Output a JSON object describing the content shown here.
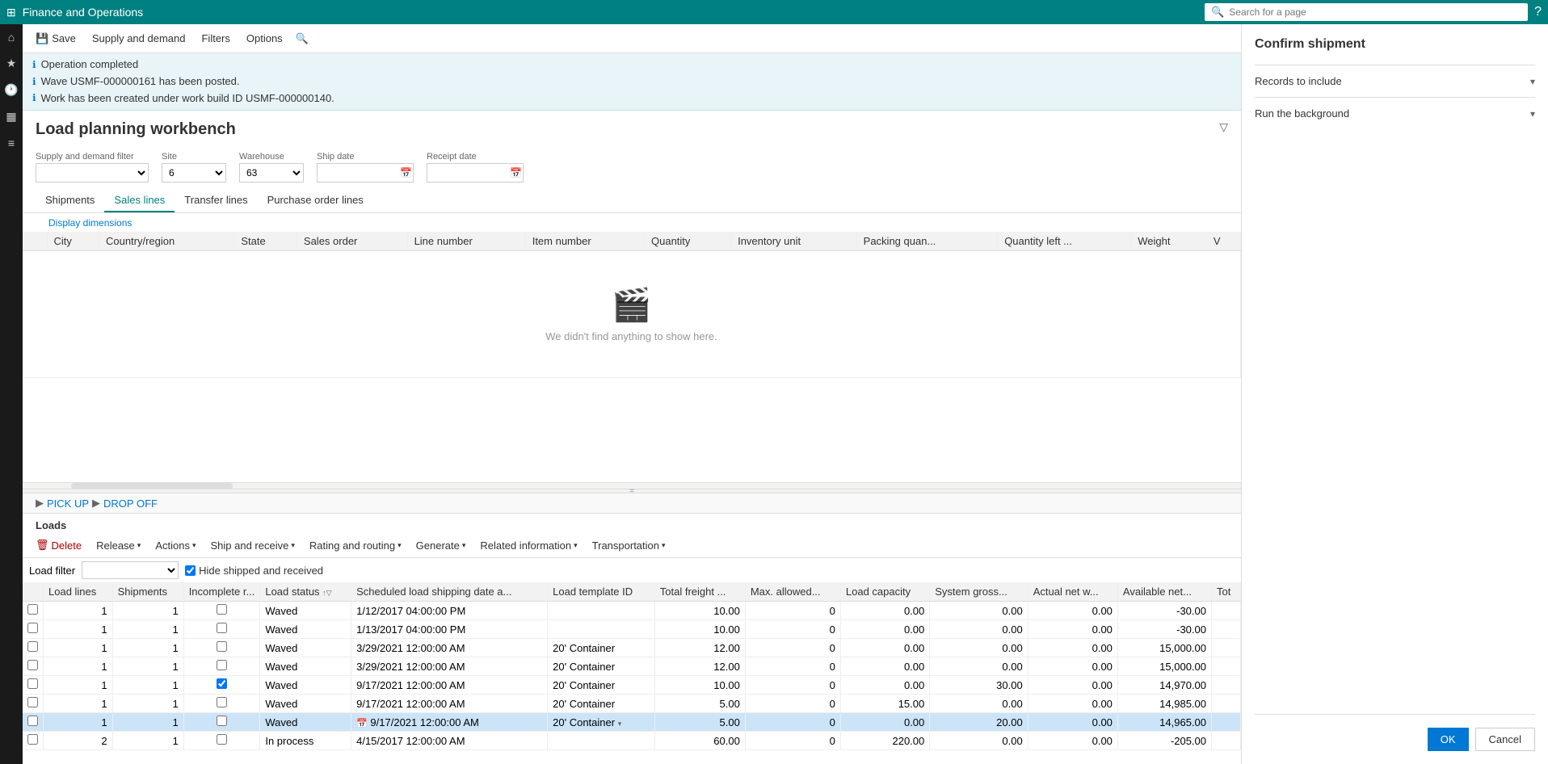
{
  "app": {
    "title": "Finance and Operations",
    "help_icon": "?"
  },
  "topbar": {
    "search_placeholder": "Search for a page"
  },
  "toolbar": {
    "save_label": "Save",
    "supply_demand_label": "Supply and demand",
    "filters_label": "Filters",
    "options_label": "Options"
  },
  "notifications": [
    {
      "text": "Operation completed"
    },
    {
      "text": "Wave USMF-000000161 has been posted."
    },
    {
      "text": "Work has been created under work build ID USMF-000000140."
    }
  ],
  "page": {
    "title": "Load planning workbench"
  },
  "filters": {
    "supply_demand_label": "Supply and demand filter",
    "supply_demand_value": "",
    "site_label": "Site",
    "site_value": "6",
    "warehouse_label": "Warehouse",
    "warehouse_value": "63",
    "ship_date_label": "Ship date",
    "ship_date_value": "",
    "receipt_date_label": "Receipt date",
    "receipt_date_value": ""
  },
  "tabs": [
    {
      "label": "Shipments",
      "active": false
    },
    {
      "label": "Sales lines",
      "active": true
    },
    {
      "label": "Transfer lines",
      "active": false
    },
    {
      "label": "Purchase order lines",
      "active": false
    }
  ],
  "display_dimensions": "Display dimensions",
  "sales_lines_grid": {
    "columns": [
      "City",
      "Country/region",
      "State",
      "Sales order",
      "Line number",
      "Item number",
      "Quantity",
      "Inventory unit",
      "Packing quan...",
      "Quantity left ...",
      "Weight",
      "V"
    ],
    "empty_text": "We didn't find anything to show here."
  },
  "breadcrumb": {
    "pickup": "PICK UP",
    "dropoff": "DROP OFF"
  },
  "loads": {
    "title": "Loads",
    "filter_label": "Load filter",
    "filter_value": "",
    "hide_shipped_label": "Hide shipped and received",
    "hide_shipped_checked": true
  },
  "loads_toolbar": {
    "delete_label": "Delete",
    "release_label": "Release",
    "actions_label": "Actions",
    "ship_receive_label": "Ship and receive",
    "rating_routing_label": "Rating and routing",
    "generate_label": "Generate",
    "related_info_label": "Related information",
    "transportation_label": "Transportation"
  },
  "loads_grid": {
    "columns": [
      "Load lines",
      "Shipments",
      "Incomplete r...",
      "Load status",
      "Scheduled load shipping date a...",
      "Load template ID",
      "Total freight ...",
      "Max. allowed...",
      "Load capacity",
      "System gross...",
      "Actual net w...",
      "Available net...",
      "Tot"
    ],
    "rows": [
      {
        "load_lines": "1",
        "shipments": "1",
        "incomplete": false,
        "load_status": "Waved",
        "ship_date": "1/12/2017 04:00:00 PM",
        "template_id": "",
        "total_freight": "10.00",
        "max_allowed": "0",
        "load_capacity": "0.00",
        "sys_gross": "0.00",
        "actual_net": "0.00",
        "available_net": "-30.00",
        "tot": "",
        "selected": false
      },
      {
        "load_lines": "1",
        "shipments": "1",
        "incomplete": false,
        "load_status": "Waved",
        "ship_date": "1/13/2017 04:00:00 PM",
        "template_id": "",
        "total_freight": "10.00",
        "max_allowed": "0",
        "load_capacity": "0.00",
        "sys_gross": "0.00",
        "actual_net": "0.00",
        "available_net": "-30.00",
        "tot": "",
        "selected": false
      },
      {
        "load_lines": "1",
        "shipments": "1",
        "incomplete": false,
        "load_status": "Waved",
        "ship_date": "3/29/2021 12:00:00 AM",
        "template_id": "20' Container",
        "total_freight": "12.00",
        "max_allowed": "0",
        "load_capacity": "0.00",
        "sys_gross": "0.00",
        "actual_net": "0.00",
        "available_net": "15,000.00",
        "tot": "",
        "selected": false
      },
      {
        "load_lines": "1",
        "shipments": "1",
        "incomplete": false,
        "load_status": "Waved",
        "ship_date": "3/29/2021 12:00:00 AM",
        "template_id": "20' Container",
        "total_freight": "12.00",
        "max_allowed": "0",
        "load_capacity": "0.00",
        "sys_gross": "0.00",
        "actual_net": "0.00",
        "available_net": "15,000.00",
        "tot": "",
        "selected": false
      },
      {
        "load_lines": "1",
        "shipments": "1",
        "incomplete": true,
        "load_status": "Waved",
        "ship_date": "9/17/2021 12:00:00 AM",
        "template_id": "20' Container",
        "total_freight": "10.00",
        "max_allowed": "0",
        "load_capacity": "0.00",
        "sys_gross": "30.00",
        "actual_net": "0.00",
        "available_net": "14,970.00",
        "tot": "",
        "selected": false
      },
      {
        "load_lines": "1",
        "shipments": "1",
        "incomplete": false,
        "load_status": "Waved",
        "ship_date": "9/17/2021 12:00:00 AM",
        "template_id": "20' Container",
        "total_freight": "5.00",
        "max_allowed": "0",
        "load_capacity": "15.00",
        "sys_gross": "0.00",
        "actual_net": "0.00",
        "available_net": "14,985.00",
        "tot": "",
        "selected": false
      },
      {
        "load_lines": "1",
        "shipments": "1",
        "incomplete": false,
        "load_status": "Waved",
        "ship_date": "9/17/2021 12:00:00 AM",
        "template_id": "20' Container",
        "total_freight": "5.00",
        "max_allowed": "0",
        "load_capacity": "0.00",
        "sys_gross": "20.00",
        "actual_net": "0.00",
        "available_net": "14,965.00",
        "tot": "",
        "selected": true
      },
      {
        "load_lines": "2",
        "shipments": "1",
        "incomplete": false,
        "load_status": "In process",
        "ship_date": "4/15/2017 12:00:00 AM",
        "template_id": "",
        "total_freight": "60.00",
        "max_allowed": "0",
        "load_capacity": "220.00",
        "sys_gross": "0.00",
        "actual_net": "0.00",
        "available_net": "-205.00",
        "tot": "",
        "selected": false
      }
    ]
  },
  "right_panel": {
    "title": "Confirm shipment",
    "records_to_include_label": "Records to include",
    "run_background_label": "Run the background",
    "ok_label": "OK",
    "cancel_label": "Cancel"
  }
}
